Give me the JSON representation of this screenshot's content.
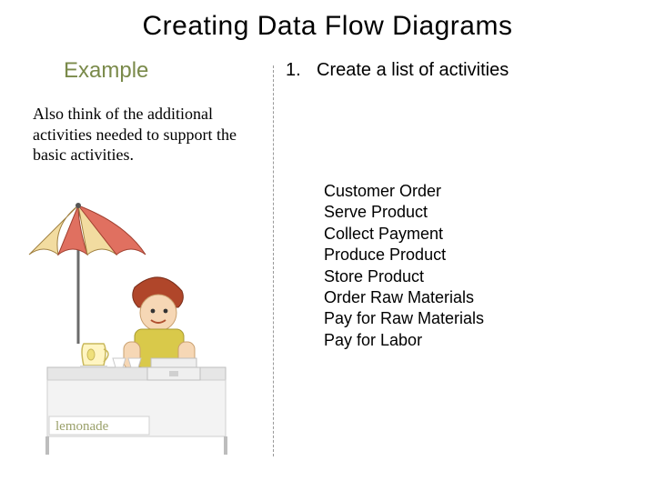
{
  "title": "Creating Data Flow Diagrams",
  "left": {
    "heading": "Example",
    "support_text": "Also think of the additional activities needed to support the basic activities."
  },
  "right": {
    "step_number": "1.",
    "step_text": "Create a list of activities",
    "activities": {
      "a0": "Customer Order",
      "a1": "Serve Product",
      "a2": "Collect Payment",
      "a3": "Produce Product",
      "a4": "Store Product",
      "a5": "Order Raw Materials",
      "a6": "Pay for Raw Materials",
      "a7": "Pay for Labor"
    }
  },
  "illustration": {
    "name": "lemonade-stand-clipart",
    "sign_text": "lemonade"
  }
}
